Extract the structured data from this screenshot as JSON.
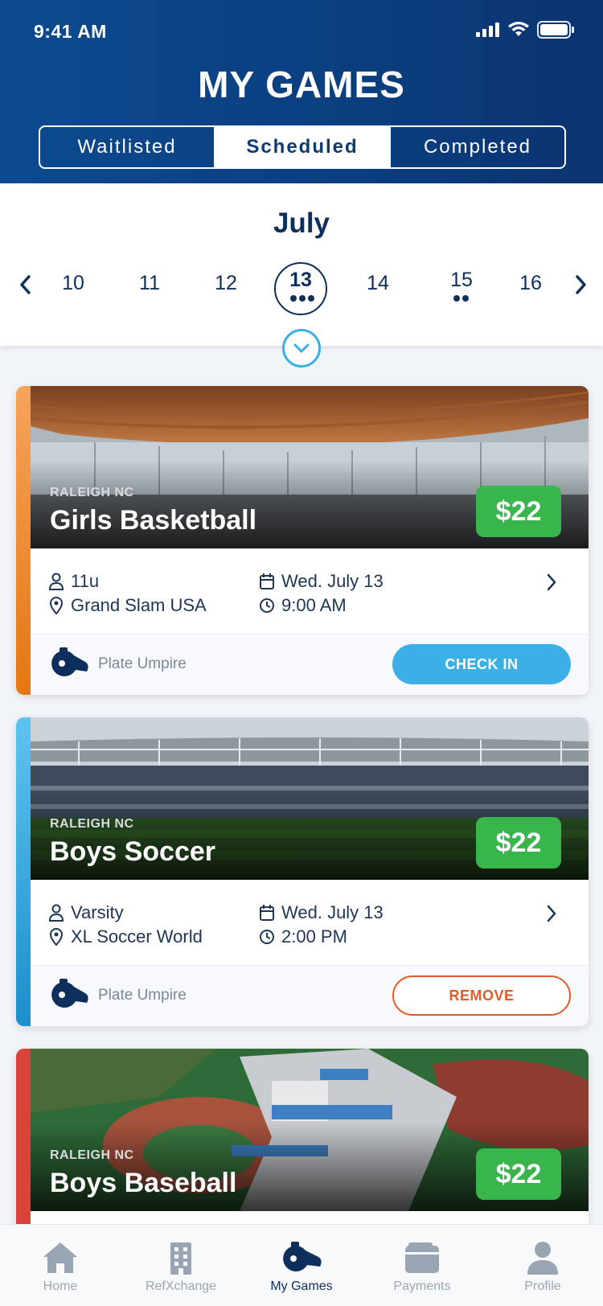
{
  "status": {
    "time": "9:41 AM"
  },
  "header": {
    "title": "MY GAMES"
  },
  "tabs": [
    {
      "label": "Waitlisted",
      "active": false
    },
    {
      "label": "Scheduled",
      "active": true
    },
    {
      "label": "Completed",
      "active": false
    }
  ],
  "calendar": {
    "month": "July",
    "days": [
      {
        "label": "10"
      },
      {
        "label": "11"
      },
      {
        "label": "12"
      },
      {
        "label": "13",
        "selected": true,
        "games": 3
      },
      {
        "label": "14"
      },
      {
        "label": "15",
        "games": 2
      },
      {
        "label": "16"
      }
    ]
  },
  "games": [
    {
      "location_tag": "RALEIGH NC",
      "sport": "Girls Basketball",
      "price": "$22",
      "level": "11u",
      "venue": "Grand Slam USA",
      "date": "Wed. July 13",
      "time": "9:00 AM",
      "role": "Plate Umpire",
      "action": "CHECK IN",
      "accent": "#f08a2a"
    },
    {
      "location_tag": "RALEIGH NC",
      "sport": "Boys Soccer",
      "price": "$22",
      "level": "Varsity",
      "venue": "XL Soccer World",
      "date": "Wed. July 13",
      "time": "2:00 PM",
      "role": "Plate Umpire",
      "action": "REMOVE",
      "accent": "#3ab0e7"
    },
    {
      "location_tag": "RALEIGH NC",
      "sport": "Boys Baseball",
      "price": "$22",
      "accent": "#d9433a"
    }
  ],
  "nav": [
    {
      "label": "Home",
      "icon": "home-icon"
    },
    {
      "label": "RefXchange",
      "icon": "building-icon"
    },
    {
      "label": "My Games",
      "icon": "whistle-icon",
      "active": true
    },
    {
      "label": "Payments",
      "icon": "wallet-icon"
    },
    {
      "label": "Profile",
      "icon": "person-icon"
    }
  ],
  "colors": {
    "header": "#0b3f80",
    "navy": "#0d2f5c",
    "price_green": "#39b64b",
    "checkin_blue": "#3ab0e7",
    "remove_orange": "#e05b2a"
  }
}
